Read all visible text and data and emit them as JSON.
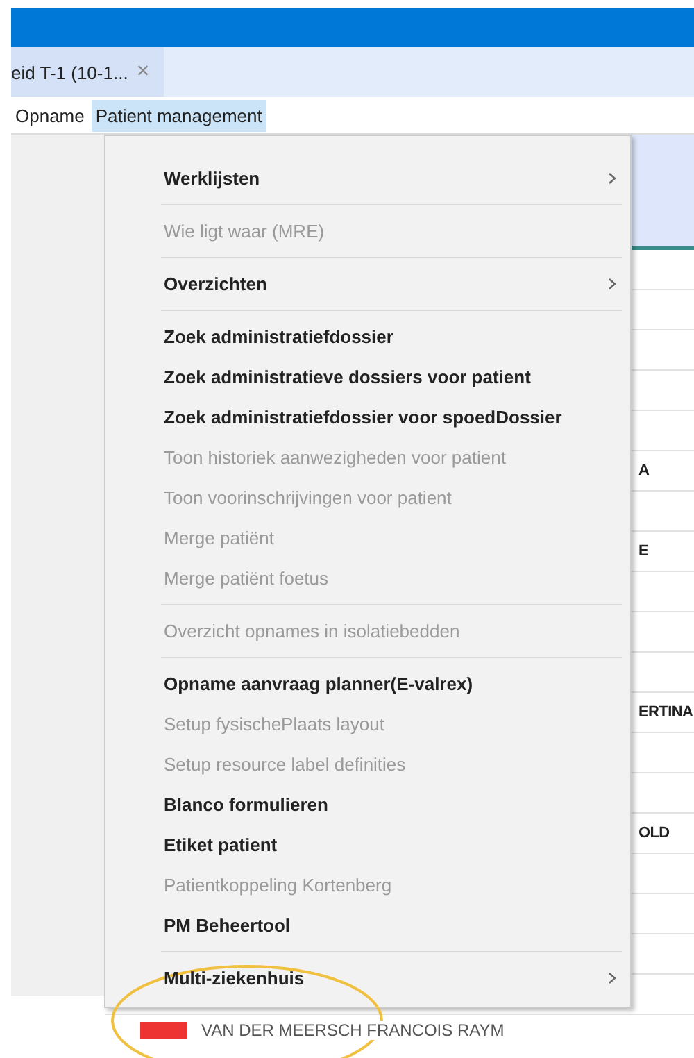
{
  "tab": {
    "title": "eid T-1 (10-1...",
    "close": "×"
  },
  "menu_bar": [
    {
      "label": "Opname",
      "selected": false
    },
    {
      "label": "Patient management",
      "selected": true
    }
  ],
  "grid": {
    "rows": [
      {},
      {},
      {},
      {},
      {},
      {
        "cell": "A"
      },
      {},
      {
        "cell": "E"
      },
      {},
      {},
      {},
      {
        "cell": "ERTINA"
      },
      {},
      {},
      {
        "cell": "OLD"
      },
      {},
      {},
      {},
      {}
    ],
    "bottom_row": "VAN DER MEERSCH FRANCOIS RAYM"
  },
  "menu": [
    {
      "kind": "item",
      "label": "Werklijsten",
      "disabled": false,
      "submenu": true
    },
    {
      "kind": "separator"
    },
    {
      "kind": "item",
      "label": "Wie ligt waar (MRE)",
      "disabled": true,
      "submenu": false
    },
    {
      "kind": "separator"
    },
    {
      "kind": "item",
      "label": "Overzichten",
      "disabled": false,
      "submenu": true
    },
    {
      "kind": "separator"
    },
    {
      "kind": "item",
      "label": "Zoek administratiefdossier",
      "disabled": false,
      "submenu": false
    },
    {
      "kind": "item",
      "label": "Zoek administratieve dossiers voor patient",
      "disabled": false,
      "submenu": false
    },
    {
      "kind": "item",
      "label": "Zoek administratiefdossier voor spoedDossier",
      "disabled": false,
      "submenu": false
    },
    {
      "kind": "item",
      "label": "Toon historiek aanwezigheden voor patient",
      "disabled": true,
      "submenu": false
    },
    {
      "kind": "item",
      "label": "Toon voorinschrijvingen voor patient",
      "disabled": true,
      "submenu": false
    },
    {
      "kind": "item",
      "label": "Merge patiënt",
      "disabled": true,
      "submenu": false
    },
    {
      "kind": "item",
      "label": "Merge patiënt foetus",
      "disabled": true,
      "submenu": false
    },
    {
      "kind": "separator"
    },
    {
      "kind": "item",
      "label": "Overzicht opnames in isolatiebedden",
      "disabled": true,
      "submenu": false
    },
    {
      "kind": "separator"
    },
    {
      "kind": "item",
      "label": "Opname aanvraag planner(E-valrex)",
      "disabled": false,
      "submenu": false
    },
    {
      "kind": "item",
      "label": "Setup fysischePlaats layout",
      "disabled": true,
      "submenu": false
    },
    {
      "kind": "item",
      "label": "Setup resource label definities",
      "disabled": true,
      "submenu": false
    },
    {
      "kind": "item",
      "label": "Blanco formulieren",
      "disabled": false,
      "submenu": false
    },
    {
      "kind": "item",
      "label": "Etiket patient",
      "disabled": false,
      "submenu": false
    },
    {
      "kind": "item",
      "label": "Patientkoppeling Kortenberg",
      "disabled": true,
      "submenu": false
    },
    {
      "kind": "item",
      "label": "PM Beheertool",
      "disabled": false,
      "submenu": false
    },
    {
      "kind": "separator"
    },
    {
      "kind": "item",
      "label": "Multi-ziekenhuis",
      "disabled": false,
      "submenu": true
    }
  ]
}
